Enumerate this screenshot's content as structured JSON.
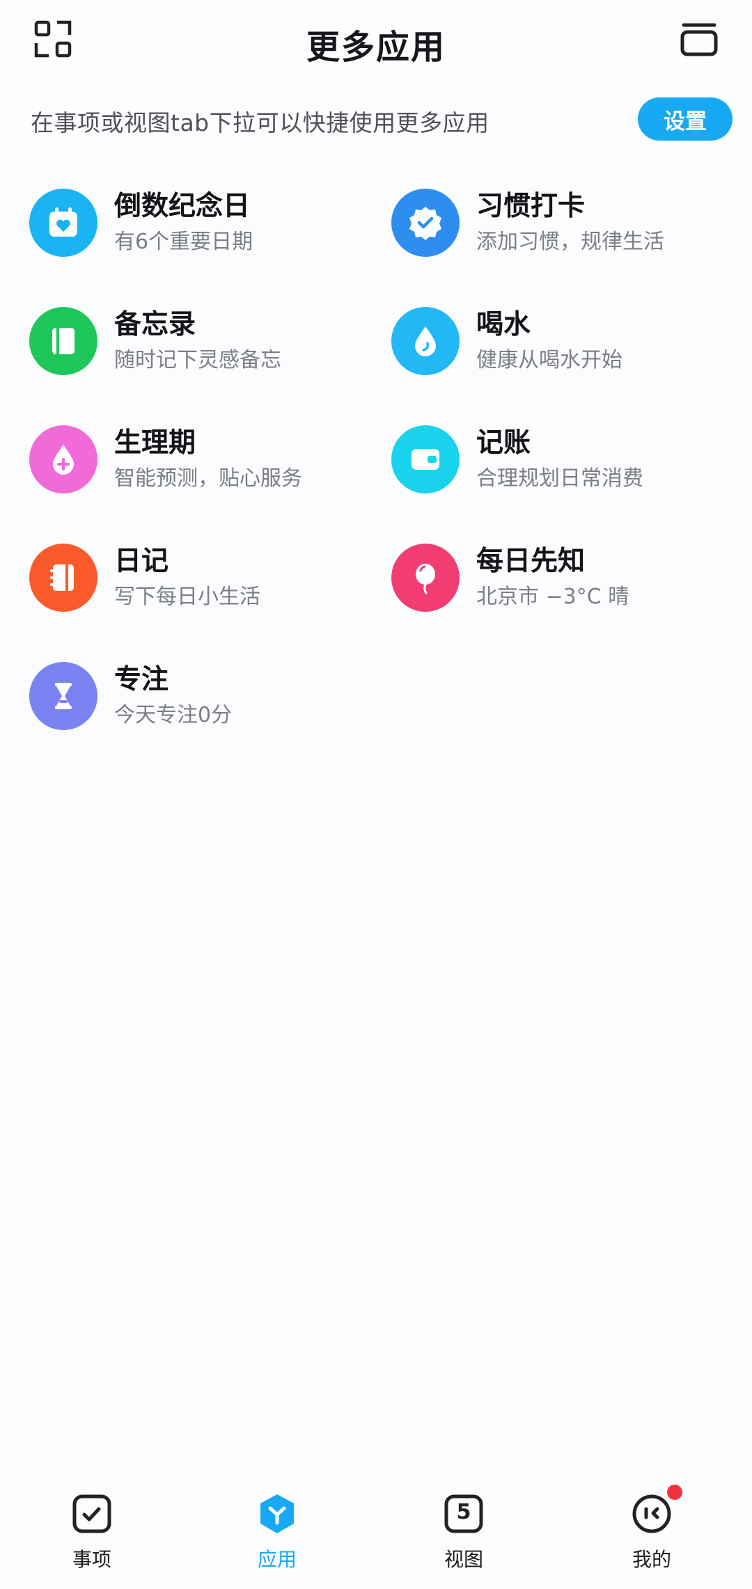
{
  "header": {
    "title": "更多应用",
    "left_icon": "scan-apps-icon",
    "right_icon": "window-icon"
  },
  "hint": {
    "text": "在事项或视图tab下拉可以快捷使用更多应用",
    "settings_label": "设置"
  },
  "apps": [
    {
      "name": "倒数纪念日",
      "desc": "有6个重要日期",
      "icon": "calendar-heart-icon",
      "color": "#1ab4f4"
    },
    {
      "name": "习惯打卡",
      "desc": "添加习惯，规律生活",
      "icon": "badge-check-icon",
      "color": "#2e8ef0"
    },
    {
      "name": "备忘录",
      "desc": "随时记下灵感备忘",
      "icon": "notebook-icon",
      "color": "#1fc75a"
    },
    {
      "name": "喝水",
      "desc": "健康从喝水开始",
      "icon": "water-drop-icon",
      "color": "#22b8f5"
    },
    {
      "name": "生理期",
      "desc": "智能预测，贴心服务",
      "icon": "drop-plus-icon",
      "color": "#f06bd8"
    },
    {
      "name": "记账",
      "desc": "合理规划日常消费",
      "icon": "wallet-icon",
      "color": "#19d3ec"
    },
    {
      "name": "日记",
      "desc": "写下每日小生活",
      "icon": "journal-icon",
      "color": "#fb5a2b"
    },
    {
      "name": "每日先知",
      "desc": "北京市 −3°C 晴",
      "icon": "balloon-icon",
      "color": "#f23d72"
    },
    {
      "name": "专注",
      "desc": "今天专注0分",
      "icon": "hourglass-icon",
      "color": "#7b82f1"
    }
  ],
  "nav": {
    "items": [
      {
        "label": "事项",
        "icon": "checkbox-icon",
        "active": false
      },
      {
        "label": "应用",
        "icon": "apps-hexagon-icon",
        "active": true
      },
      {
        "label": "视图",
        "icon": "calendar-five-icon",
        "glyph": "5",
        "active": false
      },
      {
        "label": "我的",
        "icon": "profile-face-icon",
        "active": false
      }
    ],
    "active_color": "#17a9f3",
    "badge_color": "#f2333f"
  }
}
